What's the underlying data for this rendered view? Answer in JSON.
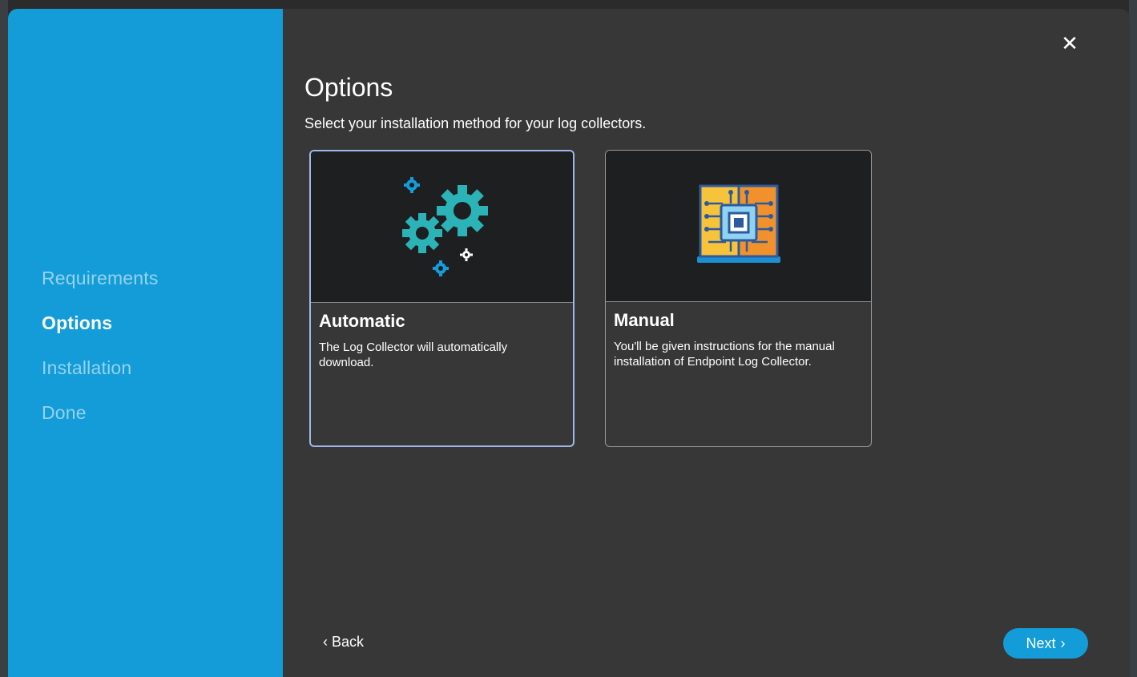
{
  "sidebar": {
    "steps": [
      {
        "label": "Requirements"
      },
      {
        "label": "Options"
      },
      {
        "label": "Installation"
      },
      {
        "label": "Done"
      }
    ],
    "active_step": "Options",
    "color": "#139cd8"
  },
  "header": {
    "title": "Options",
    "subtitle": "Select your installation method for your log collectors.",
    "close_icon": "close-icon"
  },
  "options": [
    {
      "title": "Automatic",
      "description": "The Log Collector will automatically download.",
      "icon": "gears-icon",
      "selected": true
    },
    {
      "title": "Manual",
      "description": "You'll be given instructions for the manual installation of Endpoint Log Collector.",
      "icon": "circuit-book-icon",
      "selected": false
    }
  ],
  "footer": {
    "back_label": "Back",
    "next_label": "Next",
    "back_icon": "chevron-left-icon",
    "next_icon": "chevron-right-icon"
  },
  "colors": {
    "accent": "#139cd8",
    "panel_bg": "#373737",
    "selected_border": "#9fb8e8"
  }
}
